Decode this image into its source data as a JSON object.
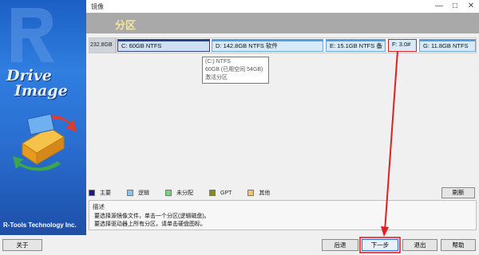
{
  "window": {
    "title": "镜像"
  },
  "banner": {
    "product_line1": "Drive",
    "product_line2": "Image",
    "company": "R-Tools Technology Inc."
  },
  "header": {
    "title": "分区"
  },
  "disk": {
    "label": "232.8GB",
    "partitions": [
      {
        "text": "C:  60GB  NTFS"
      },
      {
        "text": "D:  142.8GB  NTFS  软件"
      },
      {
        "text": "E:  15.1GB  NTFS  备"
      },
      {
        "text": "F:  3.0#"
      },
      {
        "text": "G:  11.8GB  NTFS"
      }
    ]
  },
  "tooltip": {
    "line1": "(C:) NTFS",
    "line2": "60GB (已用空间 54GB)",
    "line3": "激活分区"
  },
  "legend": [
    {
      "label": "主要",
      "color": "#1a1a7a"
    },
    {
      "label": "逻辑",
      "color": "#8ec3ea"
    },
    {
      "label": "未分配",
      "color": "#7ed07e"
    },
    {
      "label": "GPT",
      "color": "#8a8a1a"
    },
    {
      "label": "其他",
      "color": "#f2c27a"
    }
  ],
  "buttons": {
    "refresh": "刷新",
    "about": "关于",
    "back": "后退",
    "next": "下一步",
    "exit": "退出",
    "help": "帮助"
  },
  "description": {
    "title": "描述",
    "line1": "要选择源镜像文件，单击一个分区(逻辑磁盘)。",
    "line2": "要选择驱动器上所有分区，请单击硬盘图标。"
  },
  "colors": {
    "annotation": "#e02020",
    "header_bg": "#a9a9a9",
    "banner_blue": "#2f7ee0"
  }
}
